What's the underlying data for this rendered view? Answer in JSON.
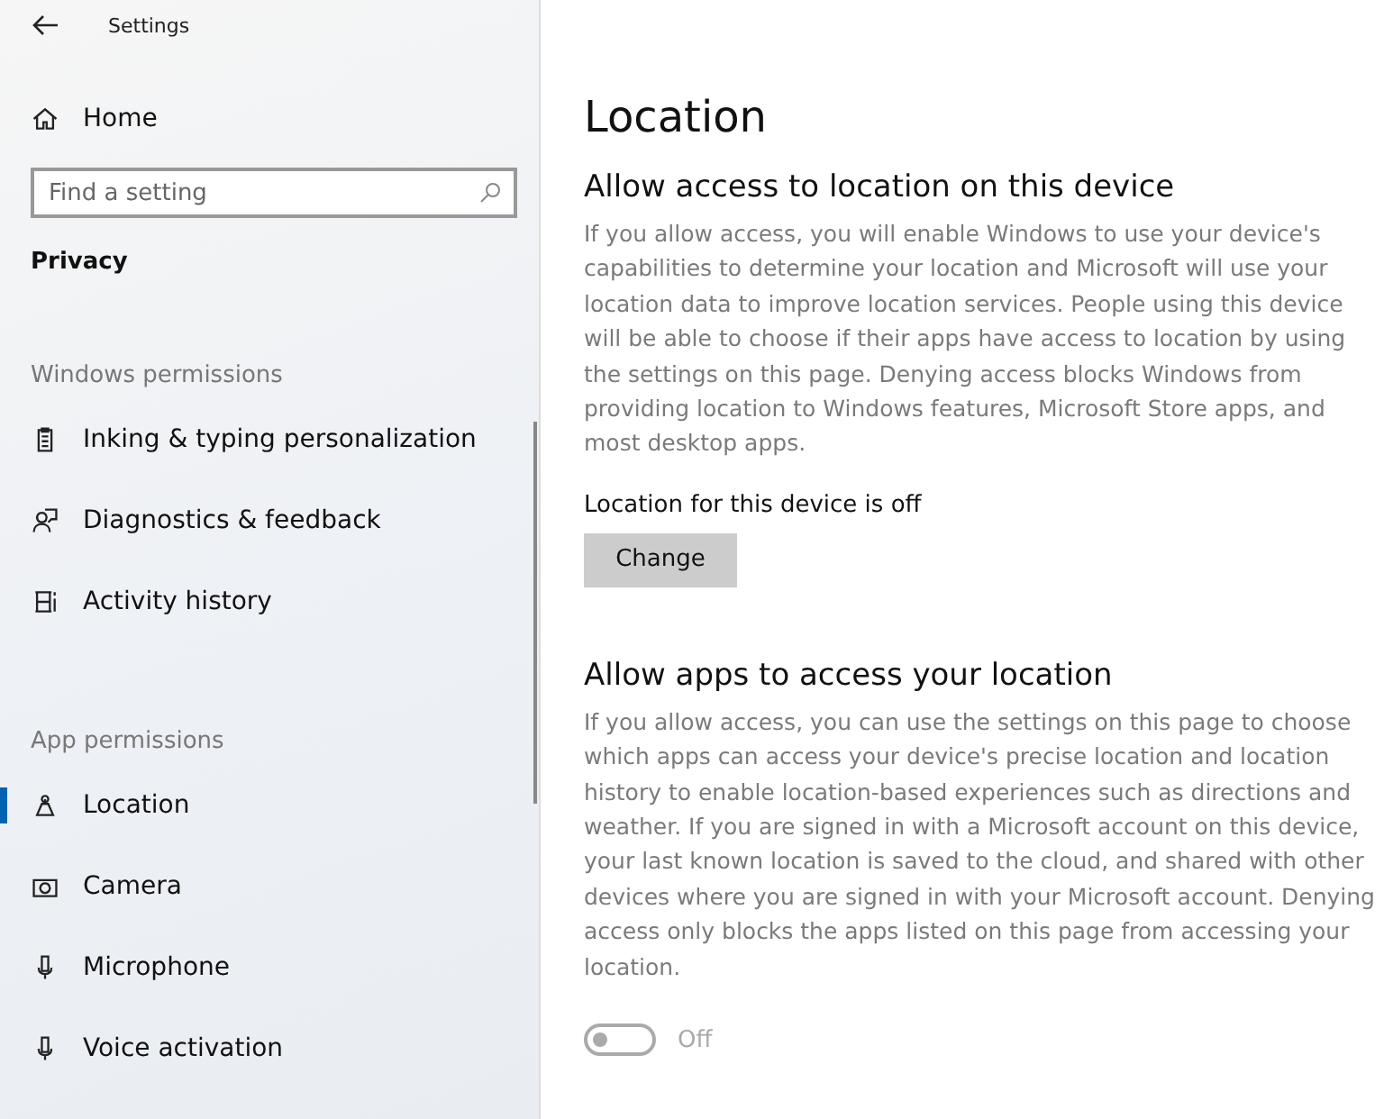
{
  "window": {
    "title": "Settings"
  },
  "home": {
    "label": "Home"
  },
  "search": {
    "placeholder": "Find a setting"
  },
  "category": "Privacy",
  "sections": [
    {
      "heading": "Windows permissions",
      "items": [
        {
          "label": "Inking & typing personalization",
          "selected": false
        },
        {
          "label": "Diagnostics & feedback",
          "selected": false
        },
        {
          "label": "Activity history",
          "selected": false
        }
      ]
    },
    {
      "heading": "App permissions",
      "items": [
        {
          "label": "Location",
          "selected": true
        },
        {
          "label": "Camera",
          "selected": false
        },
        {
          "label": "Microphone",
          "selected": false
        },
        {
          "label": "Voice activation",
          "selected": false
        }
      ]
    }
  ],
  "page": {
    "title": "Location",
    "device": {
      "heading": "Allow access to location on this device",
      "description": "If you allow access, you will enable Windows to use your device's capabilities to determine your location and Microsoft will use your location data to improve location services. People using this device will be able to choose if their apps have access to location by using the settings on this page. Denying access blocks Windows from providing location to Windows features, Microsoft Store apps, and most desktop apps.",
      "status": "Location for this device is off",
      "button": "Change"
    },
    "apps": {
      "heading": "Allow apps to access your location",
      "description": "If you allow access, you can use the settings on this page to choose which apps can access your device's precise location and location history to enable location-based experiences such as directions and weather. If you are signed in with a Microsoft account on this device, your last known location is saved to the cloud, and shared with other devices where you are signed in with your Microsoft account. Denying access only blocks the apps listed on this page from accessing your location.",
      "toggle": {
        "on": false,
        "disabled": true,
        "label": "Off"
      }
    }
  }
}
